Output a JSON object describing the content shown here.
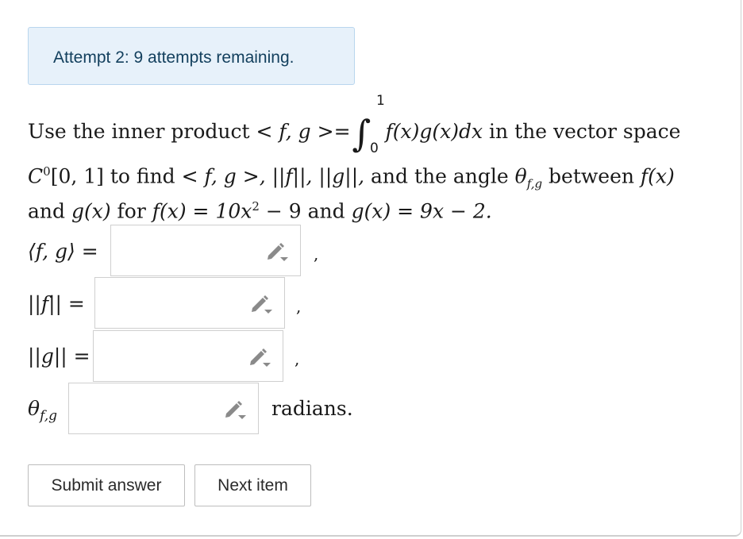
{
  "alert": {
    "text": "Attempt 2: 9 attempts remaining."
  },
  "question": {
    "line1_a": "Use the inner product",
    "line1_ip": "< f, g >=",
    "integral_sign": "∫",
    "upper_limit": "1",
    "lower_limit": "0",
    "integrand": "f(x)g(x)dx",
    "line1_b": "in the vector space",
    "line2_space": "C",
    "line2_space_sup": "0",
    "line2_interval": "[0, 1]",
    "line2_a": "to find",
    "line2_ip": "< f, g >",
    "line2_norms": ", ||f||, ||g||,",
    "line2_b": "and the angle",
    "theta": "θ",
    "theta_sub": "f,g",
    "line2_c": "between",
    "line2_fx": "f(x)",
    "line3_a": "and",
    "line3_gx": "g(x)",
    "line3_b": "for",
    "line3_fdef": "f(x) = 10x",
    "line3_fsup": "2",
    "line3_fdef2": "− 9",
    "line3_c": "and",
    "line3_gdef": "g(x) = 9x − 2."
  },
  "answers": [
    {
      "label": "⟨f, g⟩ =",
      "value": "",
      "suffix": ","
    },
    {
      "label": "||f|| =",
      "value": "",
      "suffix": ","
    },
    {
      "label": "||g|| =",
      "value": "",
      "suffix": ","
    },
    {
      "label_theta": "θ",
      "label_sub": "f,g",
      "value": "",
      "suffix": "radians."
    }
  ],
  "buttons": {
    "submit": "Submit answer",
    "next": "Next item"
  },
  "icons": {
    "answer_box": "pencil-dropdown-icon"
  },
  "colors": {
    "alert_bg": "#e7f1fa",
    "alert_text": "#123f5d",
    "icon": "#8a8a8a"
  }
}
